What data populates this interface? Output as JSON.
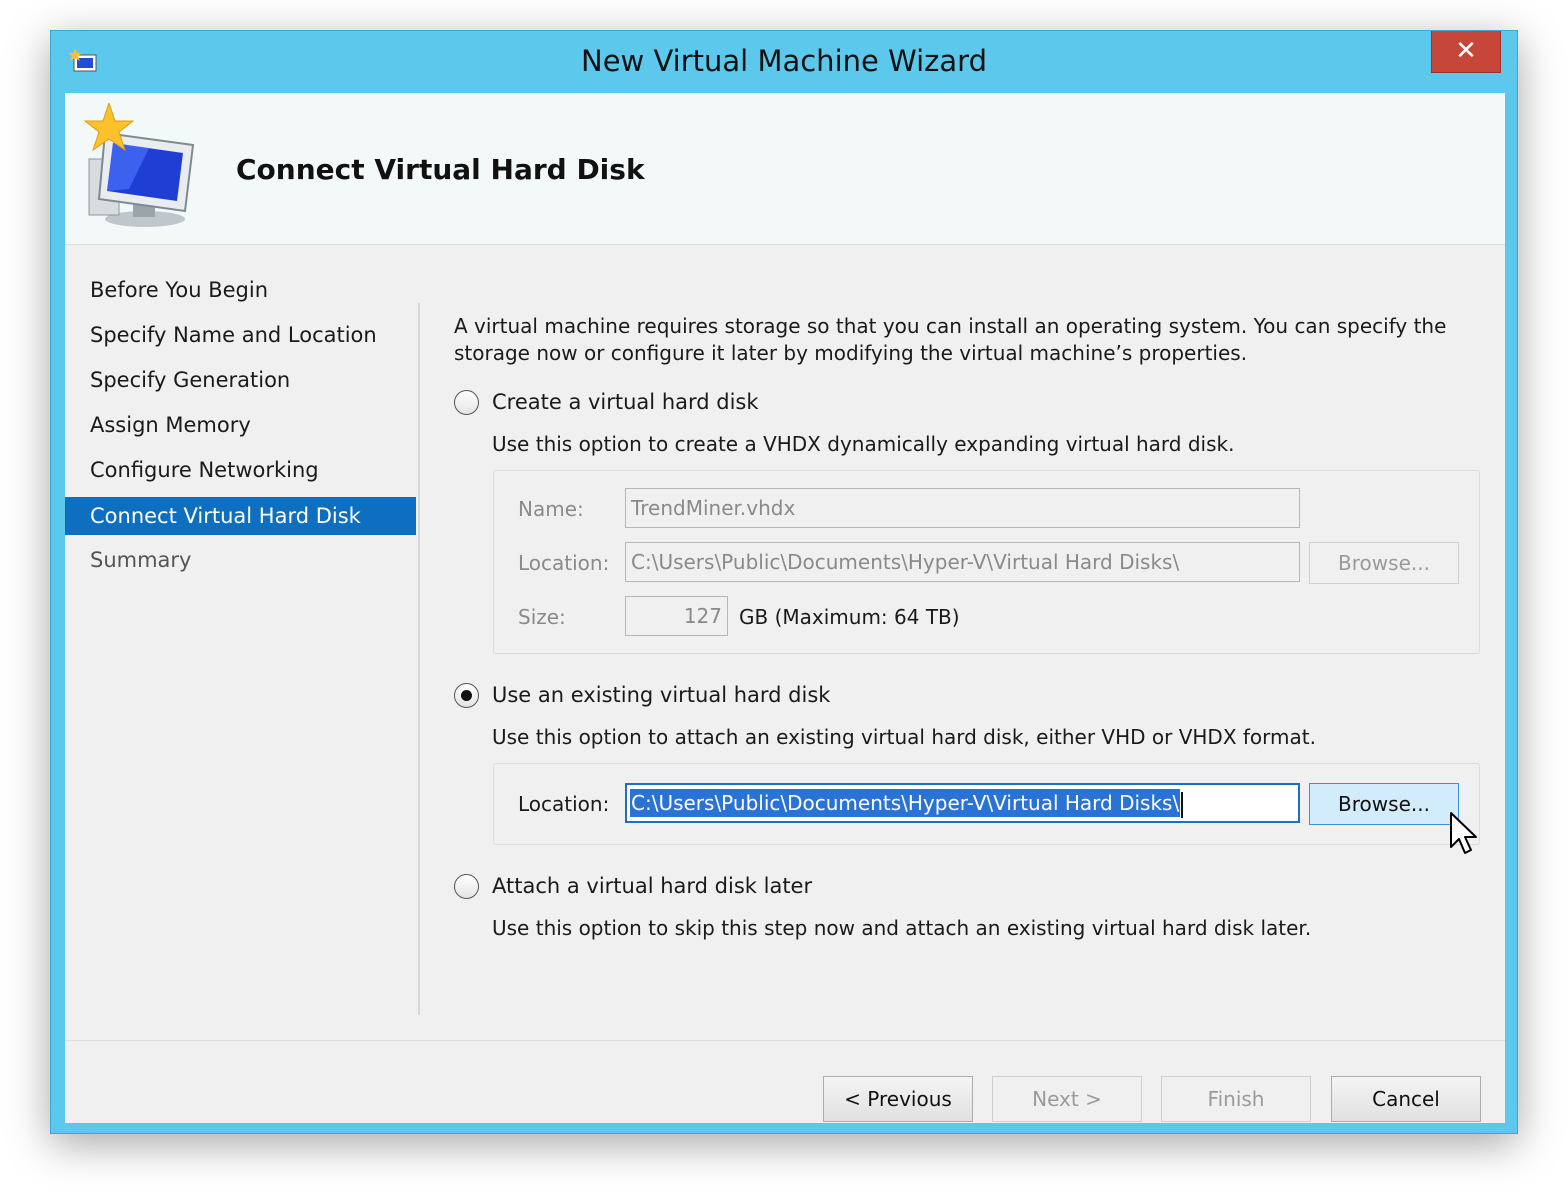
{
  "window": {
    "title": "New Virtual Machine Wizard",
    "close_label": "✕"
  },
  "header": {
    "page_title": "Connect Virtual Hard Disk"
  },
  "nav": {
    "items": [
      {
        "label": "Before You Begin"
      },
      {
        "label": "Specify Name and Location"
      },
      {
        "label": "Specify Generation"
      },
      {
        "label": "Assign Memory"
      },
      {
        "label": "Configure Networking"
      },
      {
        "label": "Connect Virtual Hard Disk"
      },
      {
        "label": "Summary"
      }
    ],
    "selected_index": 5
  },
  "content": {
    "intro": "A virtual machine requires storage so that you can install an operating system. You can specify the storage now or configure it later by modifying the virtual machine’s properties.",
    "create": {
      "label": "Create a virtual hard disk",
      "description": "Use this option to create a VHDX dynamically expanding virtual hard disk.",
      "name_label": "Name:",
      "name_value": "TrendMiner.vhdx",
      "location_label": "Location:",
      "location_value": "C:\\Users\\Public\\Documents\\Hyper-V\\Virtual Hard Disks\\",
      "browse_label": "Browse...",
      "size_label": "Size:",
      "size_value": "127",
      "size_unit": "GB (Maximum: 64 TB)"
    },
    "existing": {
      "label": "Use an existing virtual hard disk",
      "description": "Use this option to attach an existing virtual hard disk, either VHD or VHDX format.",
      "location_label": "Location:",
      "location_value": "C:\\Users\\Public\\Documents\\Hyper-V\\Virtual Hard Disks\\",
      "browse_label": "Browse..."
    },
    "later": {
      "label": "Attach a virtual hard disk later",
      "description": "Use this option to skip this step now and attach an existing virtual hard disk later."
    },
    "selected_option": "existing"
  },
  "footer": {
    "previous_label": "< Previous",
    "next_label": "Next >",
    "finish_label": "Finish",
    "cancel_label": "Cancel"
  },
  "colors": {
    "window_frame": "#5bc8ec",
    "close_button": "#c7463a",
    "nav_selected": "#0e6fc1",
    "text_selection": "#2a73d6",
    "button_hover": "#d2ecfb"
  }
}
